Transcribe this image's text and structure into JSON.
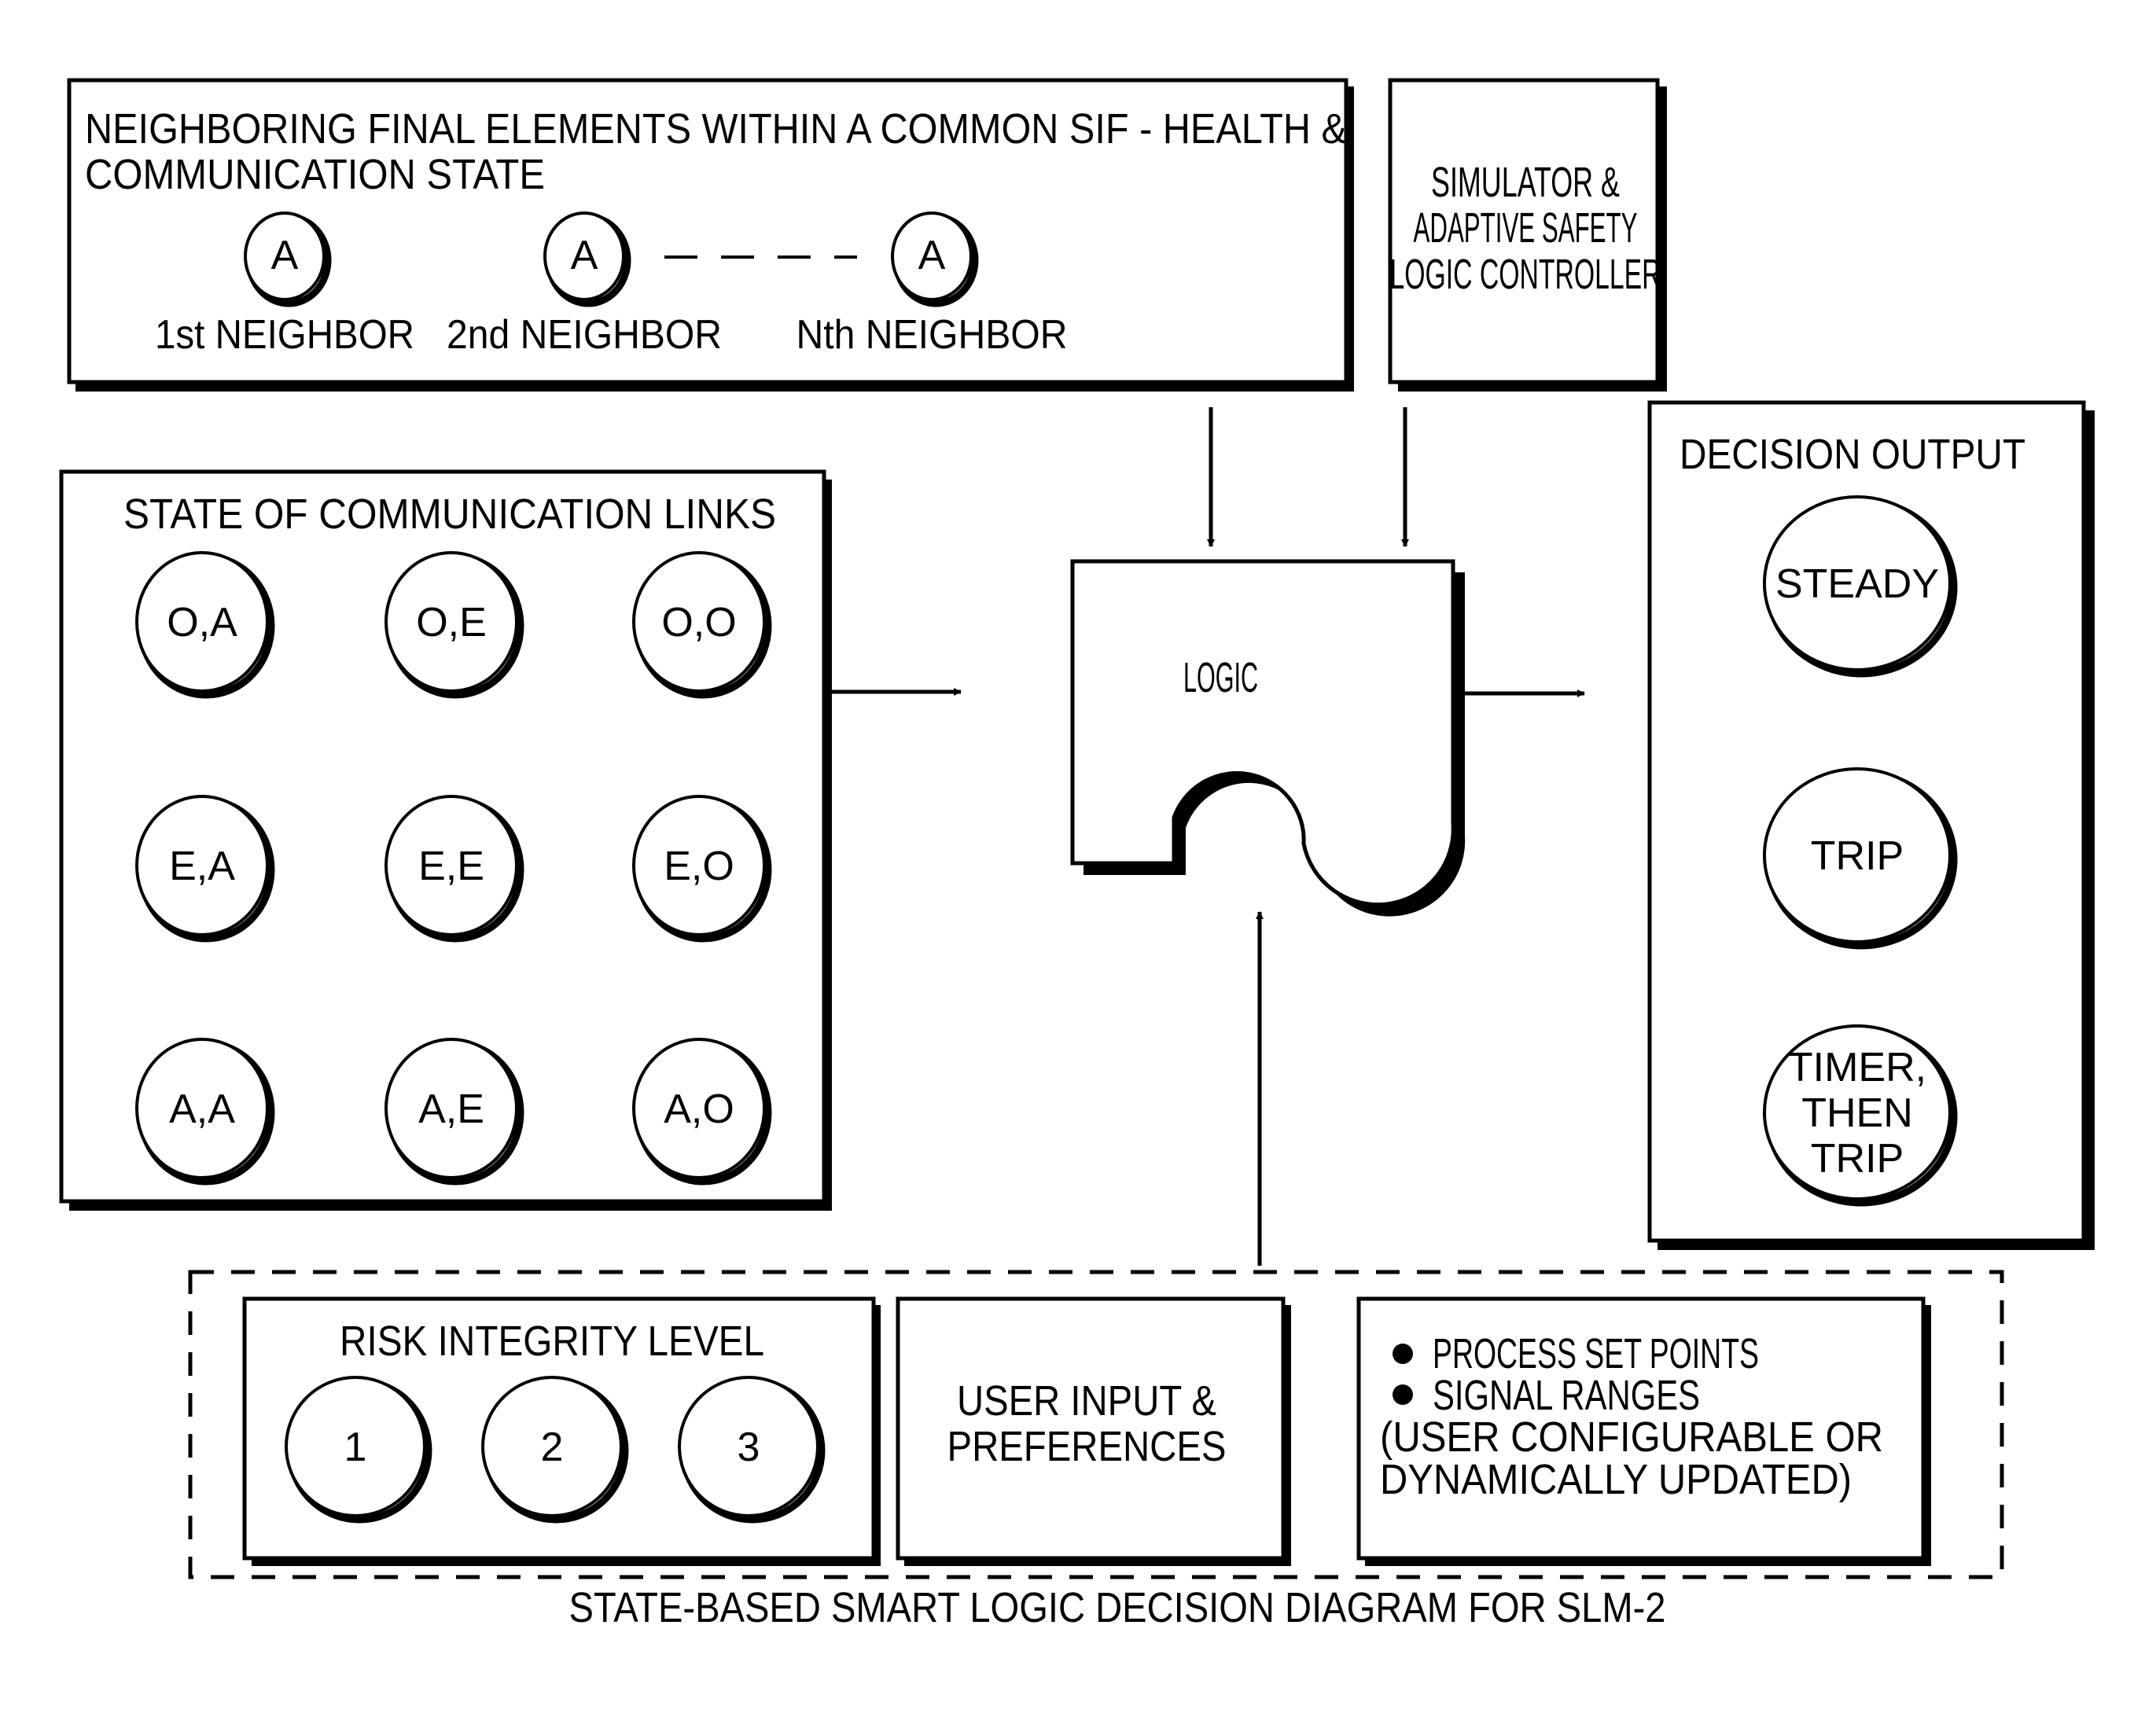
{
  "neighbors_box": {
    "title_line1": "NEIGHBORING FINAL ELEMENTS WITHIN A COMMON SIF - HEALTH &",
    "title_line2": "COMMUNICATION STATE",
    "nodes": [
      {
        "state": "A",
        "label": "1st NEIGHBOR"
      },
      {
        "state": "A",
        "label": "2nd NEIGHBOR"
      },
      {
        "state": "A",
        "label": "Nth NEIGHBOR"
      }
    ]
  },
  "simulator_box": {
    "lines": [
      "SIMULATOR &",
      "ADAPTIVE SAFETY",
      "LOGIC CONTROLLER"
    ]
  },
  "links_box": {
    "title": "STATE OF COMMUNICATION LINKS",
    "states": [
      [
        "O,A",
        "O,E",
        "O,O"
      ],
      [
        "E,A",
        "E,E",
        "E,O"
      ],
      [
        "A,A",
        "A,E",
        "A,O"
      ]
    ]
  },
  "logic_block": {
    "label": "LOGIC"
  },
  "decision_box": {
    "title": "DECISION OUTPUT",
    "outputs": [
      {
        "lines": [
          "STEADY"
        ]
      },
      {
        "lines": [
          "TRIP"
        ]
      },
      {
        "lines": [
          "TIMER,",
          "THEN",
          "TRIP"
        ]
      }
    ]
  },
  "risk_box": {
    "title": "RISK INTEGRITY LEVEL",
    "levels": [
      "1",
      "2",
      "3"
    ]
  },
  "user_box": {
    "lines": [
      "USER INPUT &",
      "PREFERENCES"
    ]
  },
  "process_box": {
    "bullets": [
      "PROCESS SET POINTS",
      "SIGNAL RANGES"
    ],
    "note_lines": [
      "(USER CONFIGURABLE OR",
      "DYNAMICALLY UPDATED)"
    ]
  },
  "caption": "STATE-BASED SMART LOGIC DECISION DIAGRAM FOR SLM-2"
}
